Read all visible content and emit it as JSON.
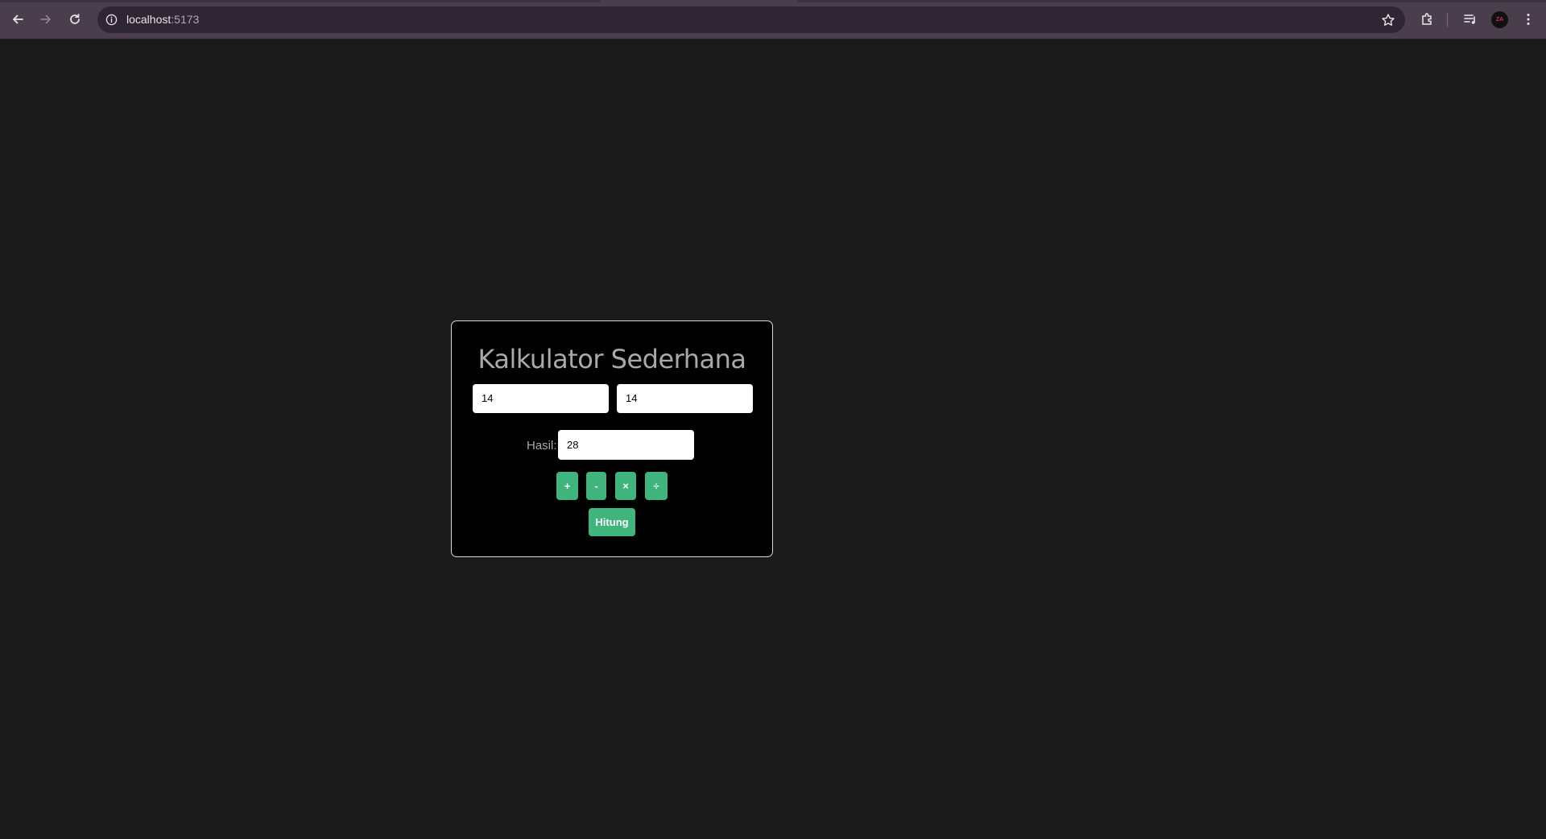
{
  "browser": {
    "url_host": "localhost",
    "url_port": ":5173",
    "avatar_initials": "ZA",
    "colors": {
      "chrome": "#4a3e4c",
      "omnibox": "#2e2632"
    }
  },
  "calculator": {
    "title": "Kalkulator Sederhana",
    "input_a": "14",
    "input_b": "14",
    "result_label": "Hasil:",
    "result_value": "28",
    "operators": [
      "+",
      "-",
      "×",
      "÷"
    ],
    "calculate_label": "Hitung",
    "colors": {
      "accent": "#3fb47c",
      "card": "#000000",
      "page": "#1a1a1a"
    }
  }
}
